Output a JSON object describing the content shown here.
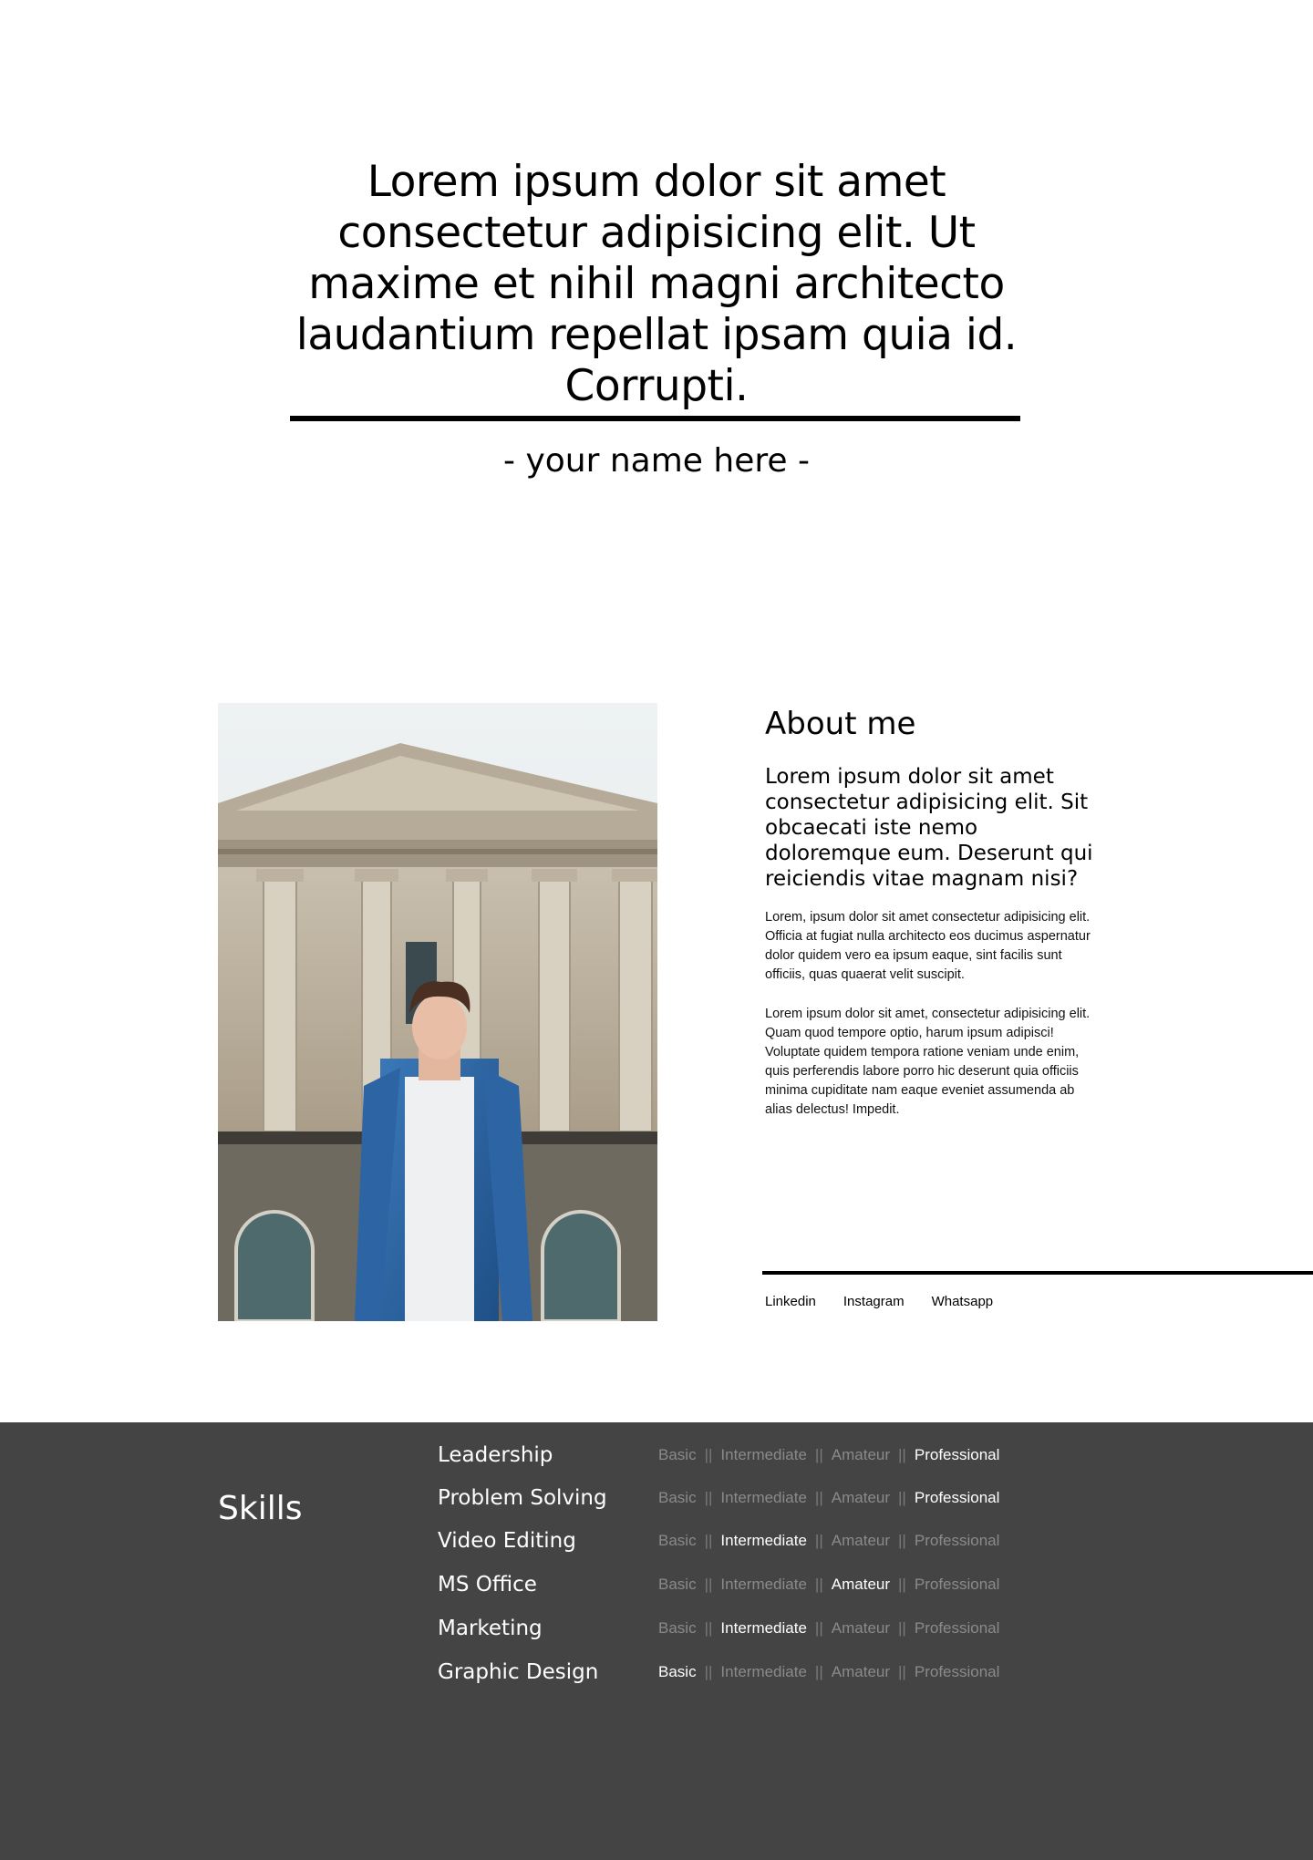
{
  "hero": {
    "quote": "Lorem ipsum dolor sit amet consectetur adipisicing elit. Ut maxime et nihil magni architecto laudantium repellat ipsam quia id. Corrupti.",
    "author": "- your name here -"
  },
  "about": {
    "title": "About me",
    "lead": "Lorem ipsum dolor sit amet consectetur adipisicing elit. Sit obcaecati iste nemo doloremque eum. Deserunt qui reiciendis vitae magnam nisi?",
    "para1": "Lorem, ipsum dolor sit amet consectetur adipisicing elit. Officia at fugiat nulla architecto eos ducimus aspernatur dolor quidem vero ea ipsum eaque, sint facilis sunt officiis, quas quaerat velit suscipit.",
    "para2": "Lorem ipsum dolor sit amet, consectetur adipisicing elit. Quam quod tempore optio, harum ipsum adipisci! Voluptate quidem tempora ratione veniam unde enim, quis perferendis labore porro hic deserunt quia officiis minima cupiditate nam eaque eveniet assumenda ab alias delectus! Impedit.",
    "social": [
      "Linkedin",
      "Instagram",
      "Whatsapp"
    ]
  },
  "skills": {
    "title": "Skills",
    "levels": [
      "Basic",
      "Intermediate",
      "Amateur",
      "Professional"
    ],
    "separator": "||",
    "items": [
      {
        "name": "Leadership",
        "level": 3
      },
      {
        "name": "Problem Solving",
        "level": 3
      },
      {
        "name": "Video Editing",
        "level": 1
      },
      {
        "name": "MS Office",
        "level": 2
      },
      {
        "name": "Marketing",
        "level": 1
      },
      {
        "name": "Graphic Design",
        "level": 0
      }
    ]
  },
  "colors": {
    "skills_bg": "#444444",
    "inactive_level": "#8a8a8a",
    "active_level": "#ffffff"
  }
}
